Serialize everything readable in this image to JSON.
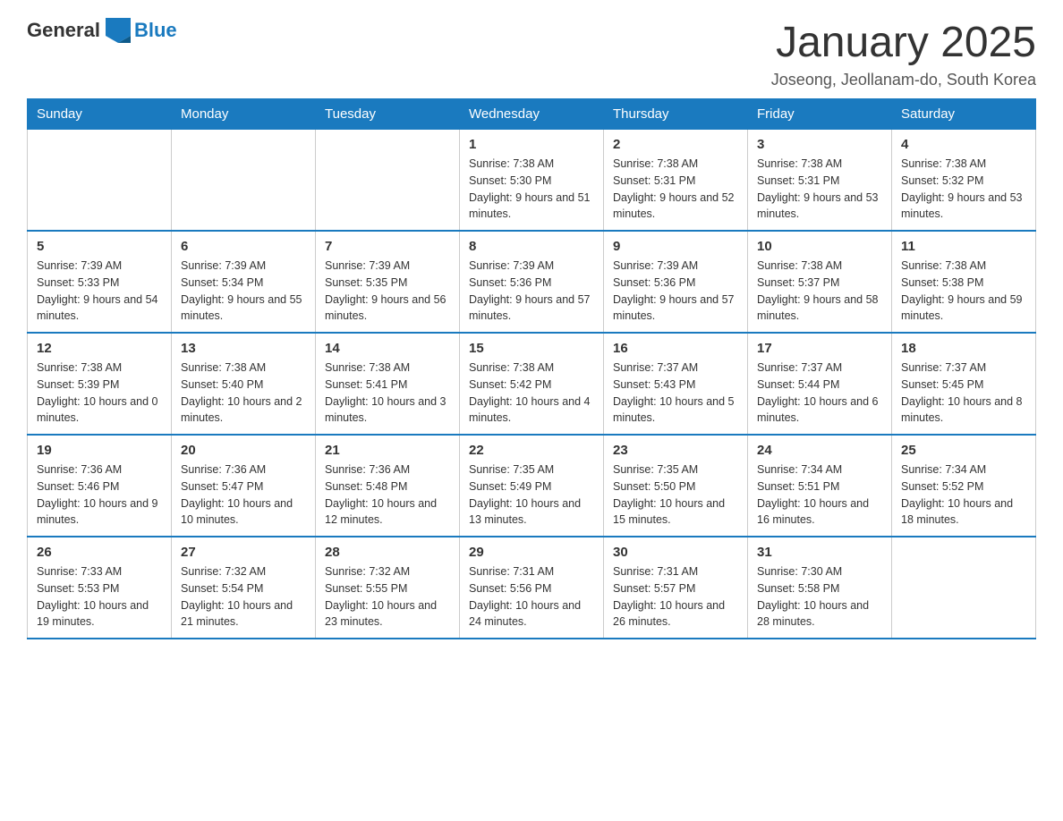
{
  "logo": {
    "general": "General",
    "blue": "Blue"
  },
  "title": "January 2025",
  "subtitle": "Joseong, Jeollanam-do, South Korea",
  "days_of_week": [
    "Sunday",
    "Monday",
    "Tuesday",
    "Wednesday",
    "Thursday",
    "Friday",
    "Saturday"
  ],
  "weeks": [
    [
      {
        "day": "",
        "info": ""
      },
      {
        "day": "",
        "info": ""
      },
      {
        "day": "",
        "info": ""
      },
      {
        "day": "1",
        "info": "Sunrise: 7:38 AM\nSunset: 5:30 PM\nDaylight: 9 hours and 51 minutes."
      },
      {
        "day": "2",
        "info": "Sunrise: 7:38 AM\nSunset: 5:31 PM\nDaylight: 9 hours and 52 minutes."
      },
      {
        "day": "3",
        "info": "Sunrise: 7:38 AM\nSunset: 5:31 PM\nDaylight: 9 hours and 53 minutes."
      },
      {
        "day": "4",
        "info": "Sunrise: 7:38 AM\nSunset: 5:32 PM\nDaylight: 9 hours and 53 minutes."
      }
    ],
    [
      {
        "day": "5",
        "info": "Sunrise: 7:39 AM\nSunset: 5:33 PM\nDaylight: 9 hours and 54 minutes."
      },
      {
        "day": "6",
        "info": "Sunrise: 7:39 AM\nSunset: 5:34 PM\nDaylight: 9 hours and 55 minutes."
      },
      {
        "day": "7",
        "info": "Sunrise: 7:39 AM\nSunset: 5:35 PM\nDaylight: 9 hours and 56 minutes."
      },
      {
        "day": "8",
        "info": "Sunrise: 7:39 AM\nSunset: 5:36 PM\nDaylight: 9 hours and 57 minutes."
      },
      {
        "day": "9",
        "info": "Sunrise: 7:39 AM\nSunset: 5:36 PM\nDaylight: 9 hours and 57 minutes."
      },
      {
        "day": "10",
        "info": "Sunrise: 7:38 AM\nSunset: 5:37 PM\nDaylight: 9 hours and 58 minutes."
      },
      {
        "day": "11",
        "info": "Sunrise: 7:38 AM\nSunset: 5:38 PM\nDaylight: 9 hours and 59 minutes."
      }
    ],
    [
      {
        "day": "12",
        "info": "Sunrise: 7:38 AM\nSunset: 5:39 PM\nDaylight: 10 hours and 0 minutes."
      },
      {
        "day": "13",
        "info": "Sunrise: 7:38 AM\nSunset: 5:40 PM\nDaylight: 10 hours and 2 minutes."
      },
      {
        "day": "14",
        "info": "Sunrise: 7:38 AM\nSunset: 5:41 PM\nDaylight: 10 hours and 3 minutes."
      },
      {
        "day": "15",
        "info": "Sunrise: 7:38 AM\nSunset: 5:42 PM\nDaylight: 10 hours and 4 minutes."
      },
      {
        "day": "16",
        "info": "Sunrise: 7:37 AM\nSunset: 5:43 PM\nDaylight: 10 hours and 5 minutes."
      },
      {
        "day": "17",
        "info": "Sunrise: 7:37 AM\nSunset: 5:44 PM\nDaylight: 10 hours and 6 minutes."
      },
      {
        "day": "18",
        "info": "Sunrise: 7:37 AM\nSunset: 5:45 PM\nDaylight: 10 hours and 8 minutes."
      }
    ],
    [
      {
        "day": "19",
        "info": "Sunrise: 7:36 AM\nSunset: 5:46 PM\nDaylight: 10 hours and 9 minutes."
      },
      {
        "day": "20",
        "info": "Sunrise: 7:36 AM\nSunset: 5:47 PM\nDaylight: 10 hours and 10 minutes."
      },
      {
        "day": "21",
        "info": "Sunrise: 7:36 AM\nSunset: 5:48 PM\nDaylight: 10 hours and 12 minutes."
      },
      {
        "day": "22",
        "info": "Sunrise: 7:35 AM\nSunset: 5:49 PM\nDaylight: 10 hours and 13 minutes."
      },
      {
        "day": "23",
        "info": "Sunrise: 7:35 AM\nSunset: 5:50 PM\nDaylight: 10 hours and 15 minutes."
      },
      {
        "day": "24",
        "info": "Sunrise: 7:34 AM\nSunset: 5:51 PM\nDaylight: 10 hours and 16 minutes."
      },
      {
        "day": "25",
        "info": "Sunrise: 7:34 AM\nSunset: 5:52 PM\nDaylight: 10 hours and 18 minutes."
      }
    ],
    [
      {
        "day": "26",
        "info": "Sunrise: 7:33 AM\nSunset: 5:53 PM\nDaylight: 10 hours and 19 minutes."
      },
      {
        "day": "27",
        "info": "Sunrise: 7:32 AM\nSunset: 5:54 PM\nDaylight: 10 hours and 21 minutes."
      },
      {
        "day": "28",
        "info": "Sunrise: 7:32 AM\nSunset: 5:55 PM\nDaylight: 10 hours and 23 minutes."
      },
      {
        "day": "29",
        "info": "Sunrise: 7:31 AM\nSunset: 5:56 PM\nDaylight: 10 hours and 24 minutes."
      },
      {
        "day": "30",
        "info": "Sunrise: 7:31 AM\nSunset: 5:57 PM\nDaylight: 10 hours and 26 minutes."
      },
      {
        "day": "31",
        "info": "Sunrise: 7:30 AM\nSunset: 5:58 PM\nDaylight: 10 hours and 28 minutes."
      },
      {
        "day": "",
        "info": ""
      }
    ]
  ]
}
